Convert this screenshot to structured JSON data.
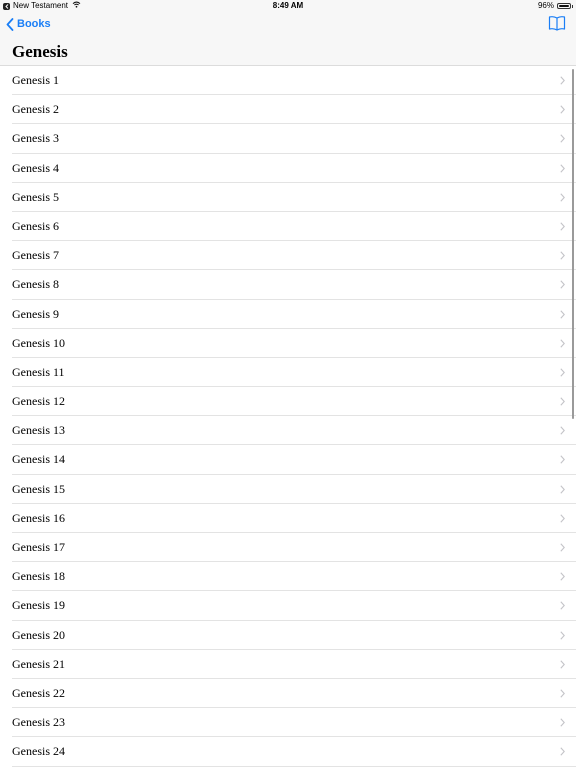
{
  "status_bar": {
    "app_name": "New Testament",
    "time": "8:49 AM",
    "battery_percent": "96%",
    "battery_level": 0.96
  },
  "nav_bar": {
    "back_label": "Books",
    "title": "Genesis",
    "accent_color": "#1a7ef6",
    "bookmark_icon": "book-icon"
  },
  "chapters": [
    "Genesis 1",
    "Genesis 2",
    "Genesis 3",
    "Genesis 4",
    "Genesis 5",
    "Genesis 6",
    "Genesis 7",
    "Genesis 8",
    "Genesis 9",
    "Genesis 10",
    "Genesis 11",
    "Genesis 12",
    "Genesis 13",
    "Genesis 14",
    "Genesis 15",
    "Genesis 16",
    "Genesis 17",
    "Genesis 18",
    "Genesis 19",
    "Genesis 20",
    "Genesis 21",
    "Genesis 22",
    "Genesis 23",
    "Genesis 24"
  ]
}
